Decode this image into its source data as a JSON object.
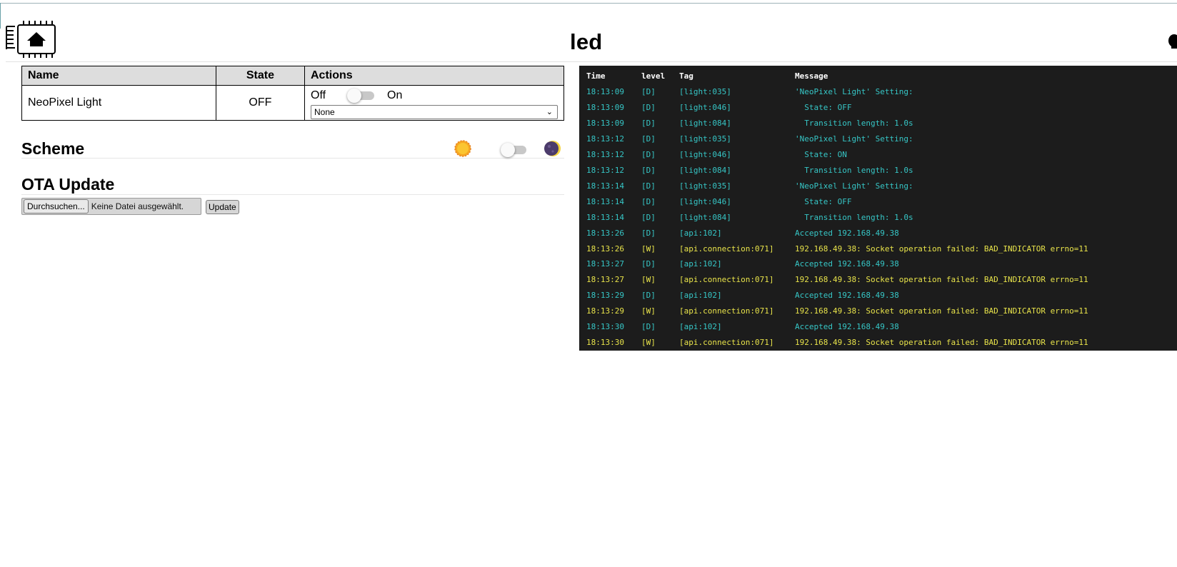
{
  "header": {
    "title": "led"
  },
  "entities_table": {
    "columns": [
      "Name",
      "State",
      "Actions"
    ],
    "rows": [
      {
        "name": "NeoPixel Light",
        "state": "OFF",
        "toggle_off_label": "Off",
        "toggle_on_label": "On",
        "toggle_on": false,
        "effect_selected": "None"
      }
    ]
  },
  "scheme": {
    "title": "Scheme",
    "icons": [
      "sun-icon",
      "moon-icon"
    ],
    "dark_mode": false
  },
  "ota": {
    "title": "OTA Update",
    "browse_button": "Durchsuchen...",
    "file_status": "Keine Datei ausgewählt.",
    "update_button": "Update"
  },
  "log": {
    "headers": {
      "time": "Time",
      "level": "level",
      "tag": "Tag",
      "message": "Message"
    },
    "colors": {
      "debug": "#36c6c6",
      "warning": "#e8e34a",
      "background": "#1c1c1c"
    },
    "entries": [
      {
        "time": "18:13:09",
        "level": "[D]",
        "tag": "[light:035]",
        "message": "'NeoPixel Light' Setting:"
      },
      {
        "time": "18:13:09",
        "level": "[D]",
        "tag": "[light:046]",
        "message": "  State: OFF"
      },
      {
        "time": "18:13:09",
        "level": "[D]",
        "tag": "[light:084]",
        "message": "  Transition length: 1.0s"
      },
      {
        "time": "18:13:12",
        "level": "[D]",
        "tag": "[light:035]",
        "message": "'NeoPixel Light' Setting:"
      },
      {
        "time": "18:13:12",
        "level": "[D]",
        "tag": "[light:046]",
        "message": "  State: ON"
      },
      {
        "time": "18:13:12",
        "level": "[D]",
        "tag": "[light:084]",
        "message": "  Transition length: 1.0s"
      },
      {
        "time": "18:13:14",
        "level": "[D]",
        "tag": "[light:035]",
        "message": "'NeoPixel Light' Setting:"
      },
      {
        "time": "18:13:14",
        "level": "[D]",
        "tag": "[light:046]",
        "message": "  State: OFF"
      },
      {
        "time": "18:13:14",
        "level": "[D]",
        "tag": "[light:084]",
        "message": "  Transition length: 1.0s"
      },
      {
        "time": "18:13:26",
        "level": "[D]",
        "tag": "[api:102]",
        "message": "Accepted 192.168.49.38"
      },
      {
        "time": "18:13:26",
        "level": "[W]",
        "tag": "[api.connection:071]",
        "message": "192.168.49.38: Socket operation failed: BAD_INDICATOR errno=11"
      },
      {
        "time": "18:13:27",
        "level": "[D]",
        "tag": "[api:102]",
        "message": "Accepted 192.168.49.38"
      },
      {
        "time": "18:13:27",
        "level": "[W]",
        "tag": "[api.connection:071]",
        "message": "192.168.49.38: Socket operation failed: BAD_INDICATOR errno=11"
      },
      {
        "time": "18:13:29",
        "level": "[D]",
        "tag": "[api:102]",
        "message": "Accepted 192.168.49.38"
      },
      {
        "time": "18:13:29",
        "level": "[W]",
        "tag": "[api.connection:071]",
        "message": "192.168.49.38: Socket operation failed: BAD_INDICATOR errno=11"
      },
      {
        "time": "18:13:30",
        "level": "[D]",
        "tag": "[api:102]",
        "message": "Accepted 192.168.49.38"
      },
      {
        "time": "18:13:30",
        "level": "[W]",
        "tag": "[api.connection:071]",
        "message": "192.168.49.38: Socket operation failed: BAD_INDICATOR errno=11"
      }
    ]
  }
}
